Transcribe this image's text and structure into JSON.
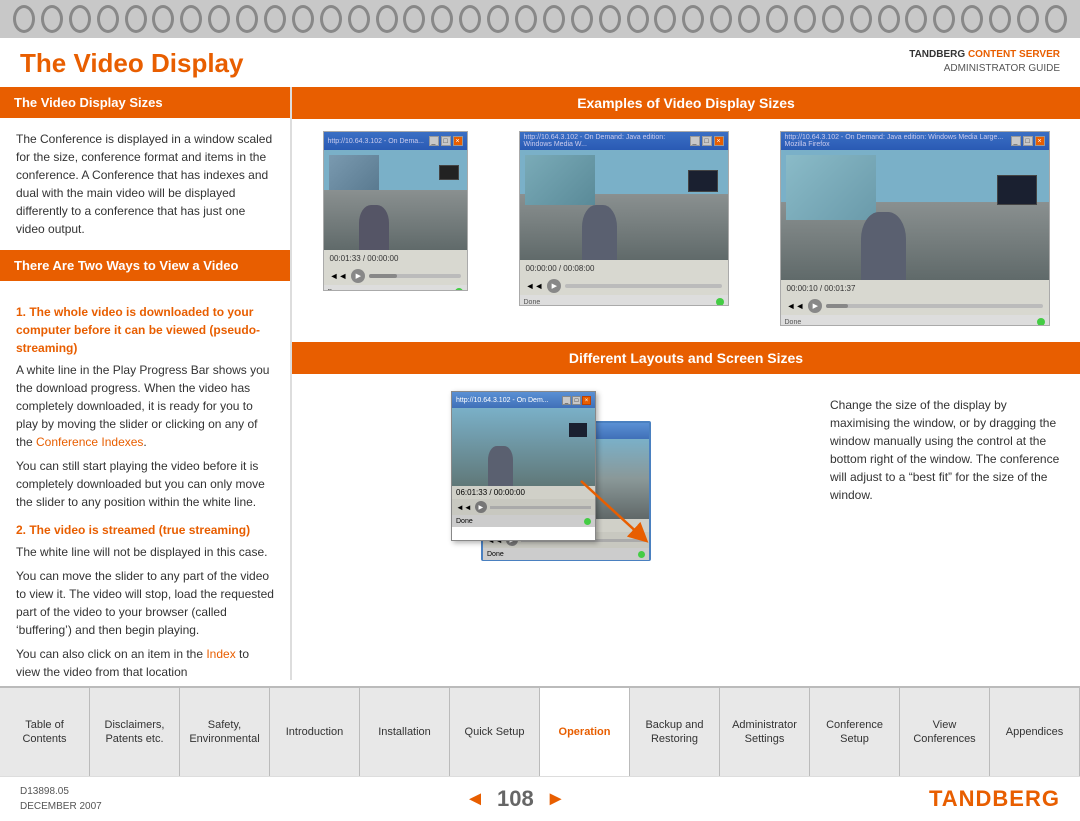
{
  "spiral": {
    "rings": 38
  },
  "header": {
    "title": "The Video Display",
    "brand_name": "TANDBERG",
    "brand_highlight": "CONTENT SERVER",
    "guide": "ADMINISTRATOR GUIDE"
  },
  "left": {
    "section1": {
      "header": "The Video Display Sizes",
      "body": "The Conference is displayed in a window scaled for the size, conference format and items in the conference. A Conference that has indexes and dual with the main video will be displayed differently to a conference that has just one video output."
    },
    "section2": {
      "header": "There Are Two Ways to View a Video",
      "item1_label": "1. The whole video is downloaded to your computer before it can be viewed (pseudo-streaming)",
      "item1_body1": "A white line in the Play Progress Bar shows you the download progress. When the video has completely downloaded, it is ready for you to play by moving the slider or clicking on any of the ",
      "item1_link1": "Conference Indexes",
      "item1_body1_end": ".",
      "item1_body2": "You can still start playing the video before it is completely downloaded but you can only move the slider to any position within the white line.",
      "item2_label": "2. The video is streamed (true streaming)",
      "item2_body1": "The white line will not be displayed in this case.",
      "item2_body2": "You can move the slider to any part of the video to view it. The video will stop, load the requested part of the video to your browser (called ‘buffering’) and then begin playing.",
      "item2_body3": "You can also click on an item in the ",
      "item2_link": "Index",
      "item2_body3_end": " to view the video from that location"
    }
  },
  "right": {
    "section1": {
      "header": "Examples of Video Display Sizes"
    },
    "section2": {
      "header": "Different Layouts and Screen Sizes",
      "body": "Change the size of the display by maximising the window, or by dragging the window manually using the control at the bottom right of the window. The conference will adjust to a “best fit” for the size of the window."
    }
  },
  "nav": {
    "tabs": [
      {
        "label": "Table of\nContents",
        "active": false
      },
      {
        "label": "Disclaimers,\nPatents etc.",
        "active": false
      },
      {
        "label": "Safety,\nEnvironmental",
        "active": false
      },
      {
        "label": "Introduction",
        "active": false
      },
      {
        "label": "Installation",
        "active": false
      },
      {
        "label": "Quick Setup",
        "active": false
      },
      {
        "label": "Operation",
        "active": true
      },
      {
        "label": "Backup and\nRestoring",
        "active": false
      },
      {
        "label": "Administrator\nSettings",
        "active": false
      },
      {
        "label": "Conference\nSetup",
        "active": false
      },
      {
        "label": "View\nConferences",
        "active": false
      },
      {
        "label": "Appendices",
        "active": false
      }
    ]
  },
  "footer": {
    "doc_number": "D13898.05",
    "date": "DECEMBER 2007",
    "page": "108",
    "brand": "TANDBERG"
  }
}
